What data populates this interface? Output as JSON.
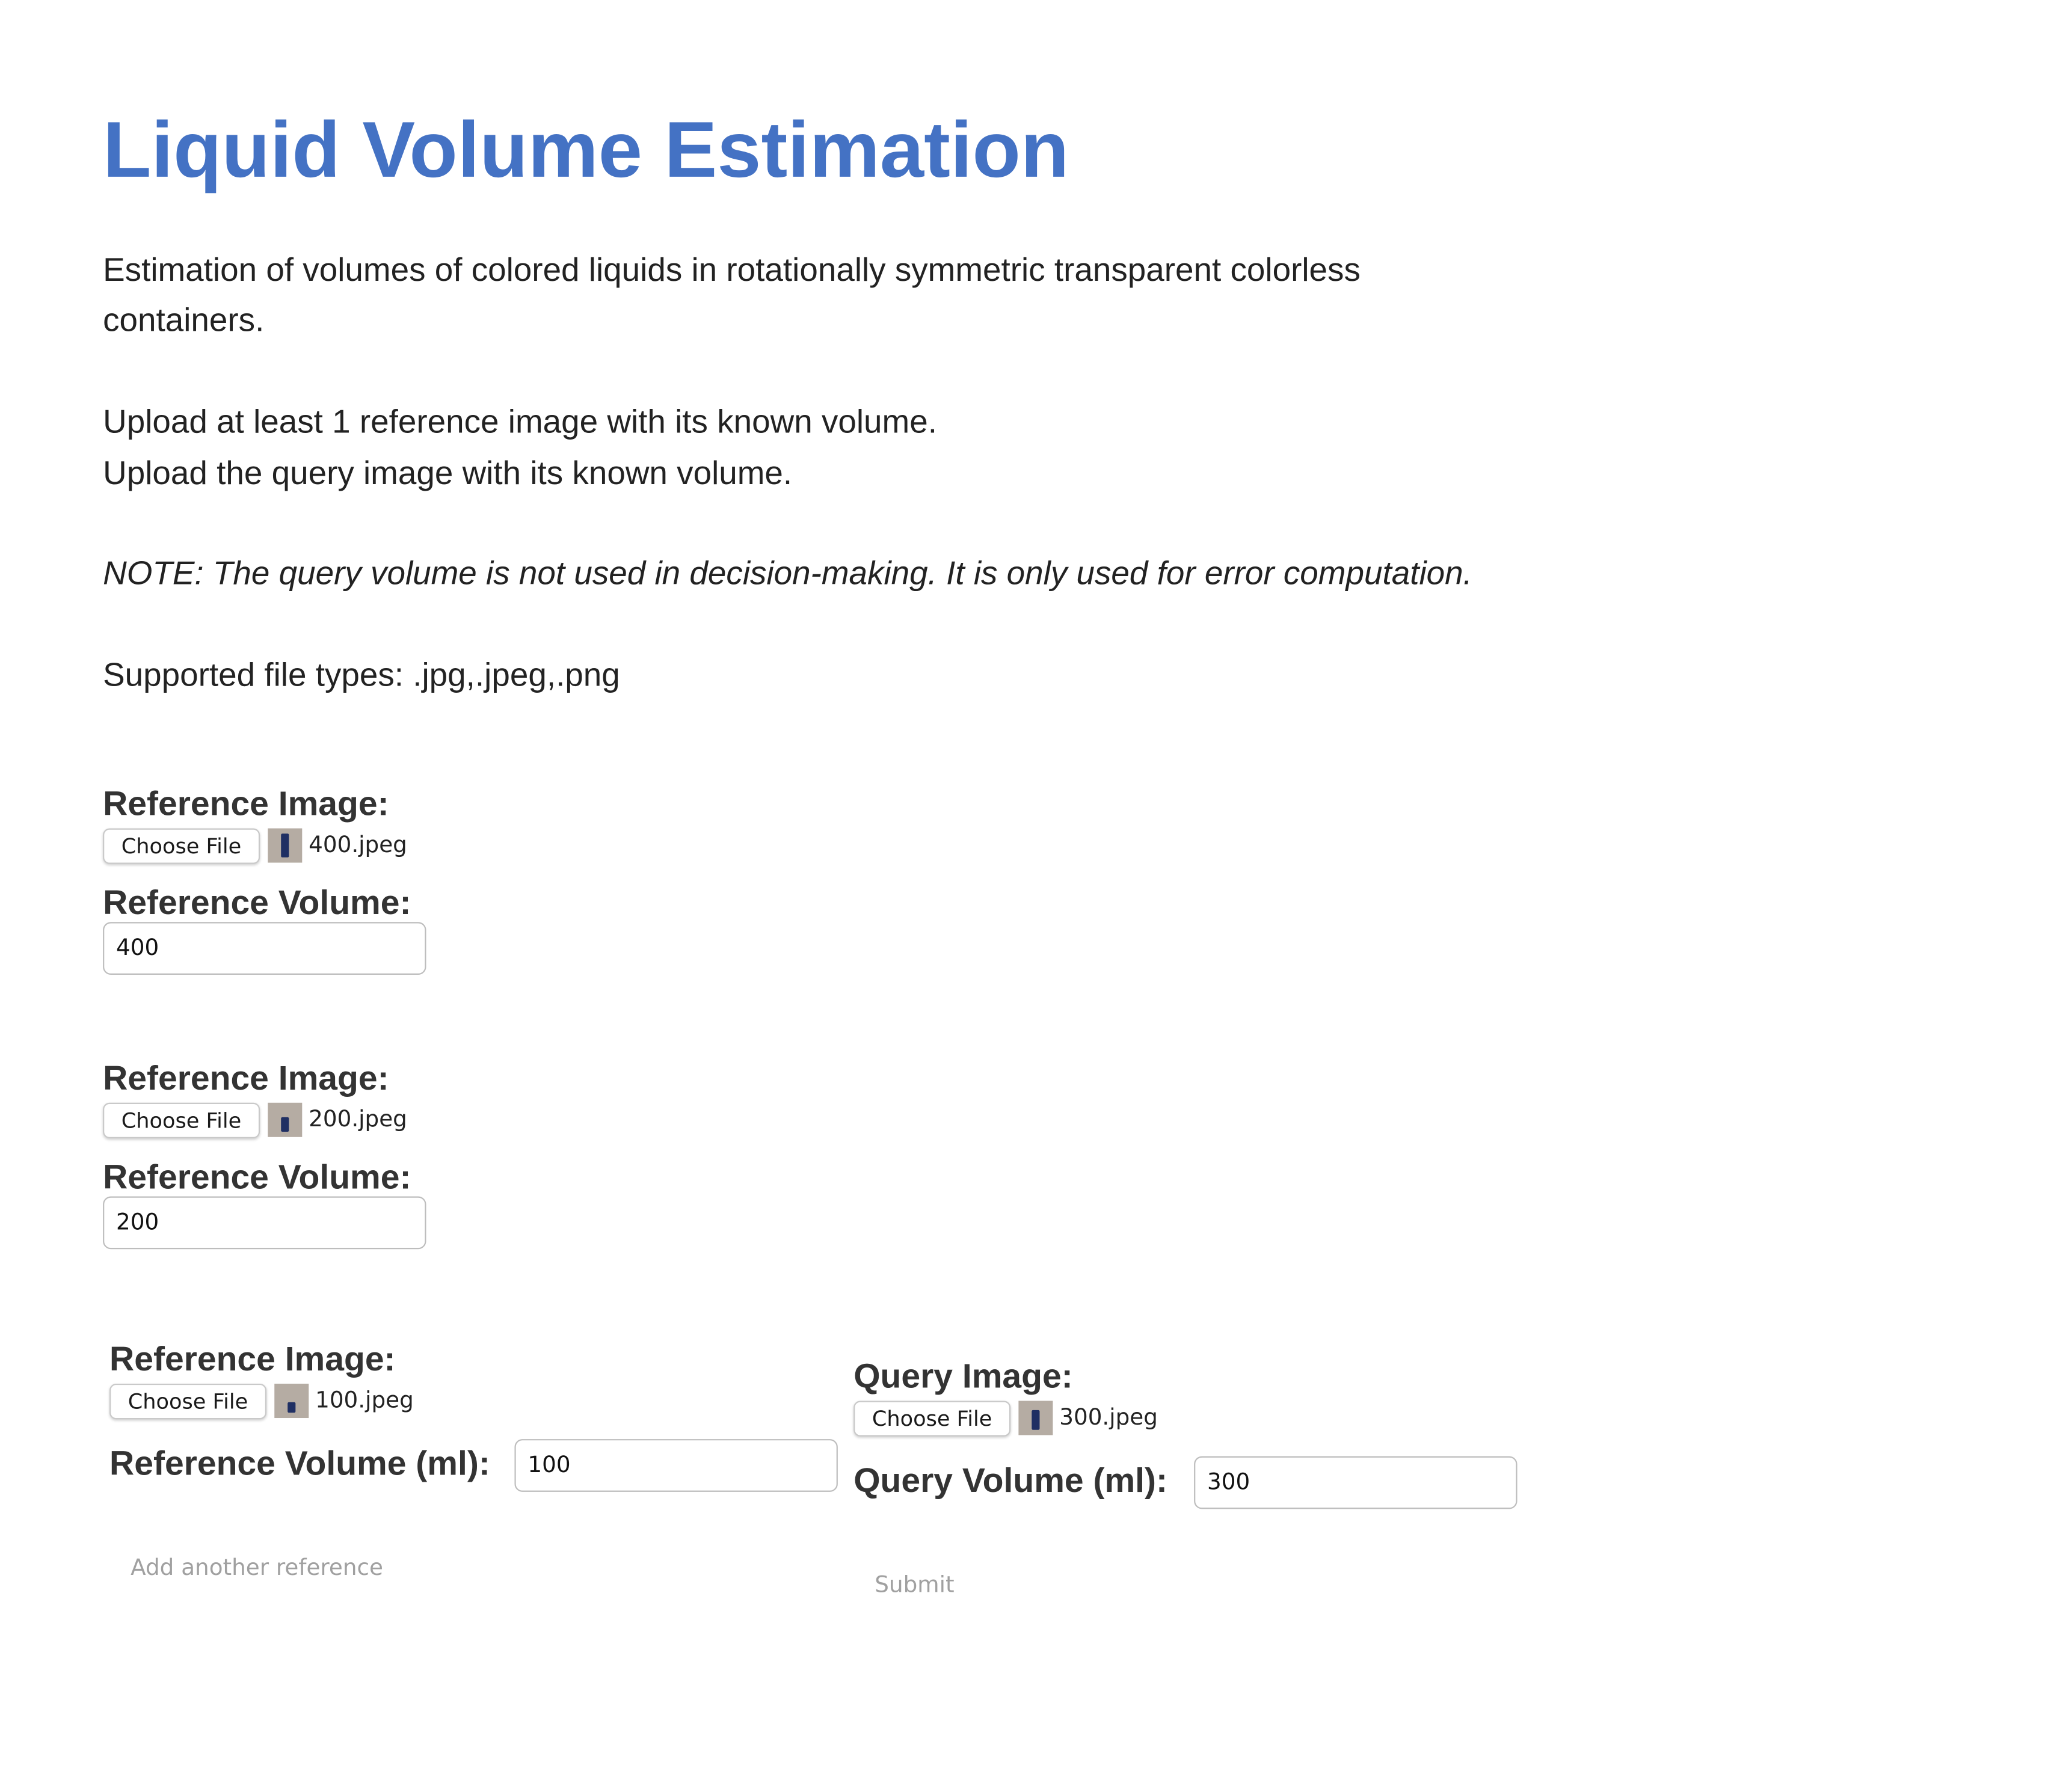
{
  "title": "Liquid Volume Estimation",
  "intro": {
    "description": "Estimation of volumes of colored liquids in rotationally symmetric transparent colorless containers.",
    "instruction_reference": "Upload at least 1 reference image with its known volume.",
    "instruction_query": "Upload the query image with its known volume.",
    "note": "NOTE: The query volume is not used in decision-making. It is only used for error computation.",
    "supported_types": "Supported file types: .jpg,.jpeg,.png"
  },
  "references": [
    {
      "image_label": "Reference Image:",
      "choose_label": "Choose File",
      "file_name": "400.jpeg",
      "volume_label": "Reference Volume:",
      "volume_value": "400"
    },
    {
      "image_label": "Reference Image:",
      "choose_label": "Choose File",
      "file_name": "200.jpeg",
      "volume_label": "Reference Volume:",
      "volume_value": "200"
    },
    {
      "image_label": "Reference Image:",
      "choose_label": "Choose File",
      "file_name": "100.jpeg",
      "volume_label": "Reference Volume (ml):",
      "volume_value": "100"
    }
  ],
  "query": {
    "image_label": "Query Image:",
    "choose_label": "Choose File",
    "file_name": "300.jpeg",
    "volume_label": "Query Volume (ml):",
    "volume_value": "300"
  },
  "actions": {
    "add_reference": "Add another reference",
    "submit": "Submit"
  },
  "colors": {
    "title": "#4472c4",
    "thumbnail_background": "#b5aca3",
    "thumbnail_liquid": "#1f2f63",
    "action_text": "#a0a0a0"
  }
}
